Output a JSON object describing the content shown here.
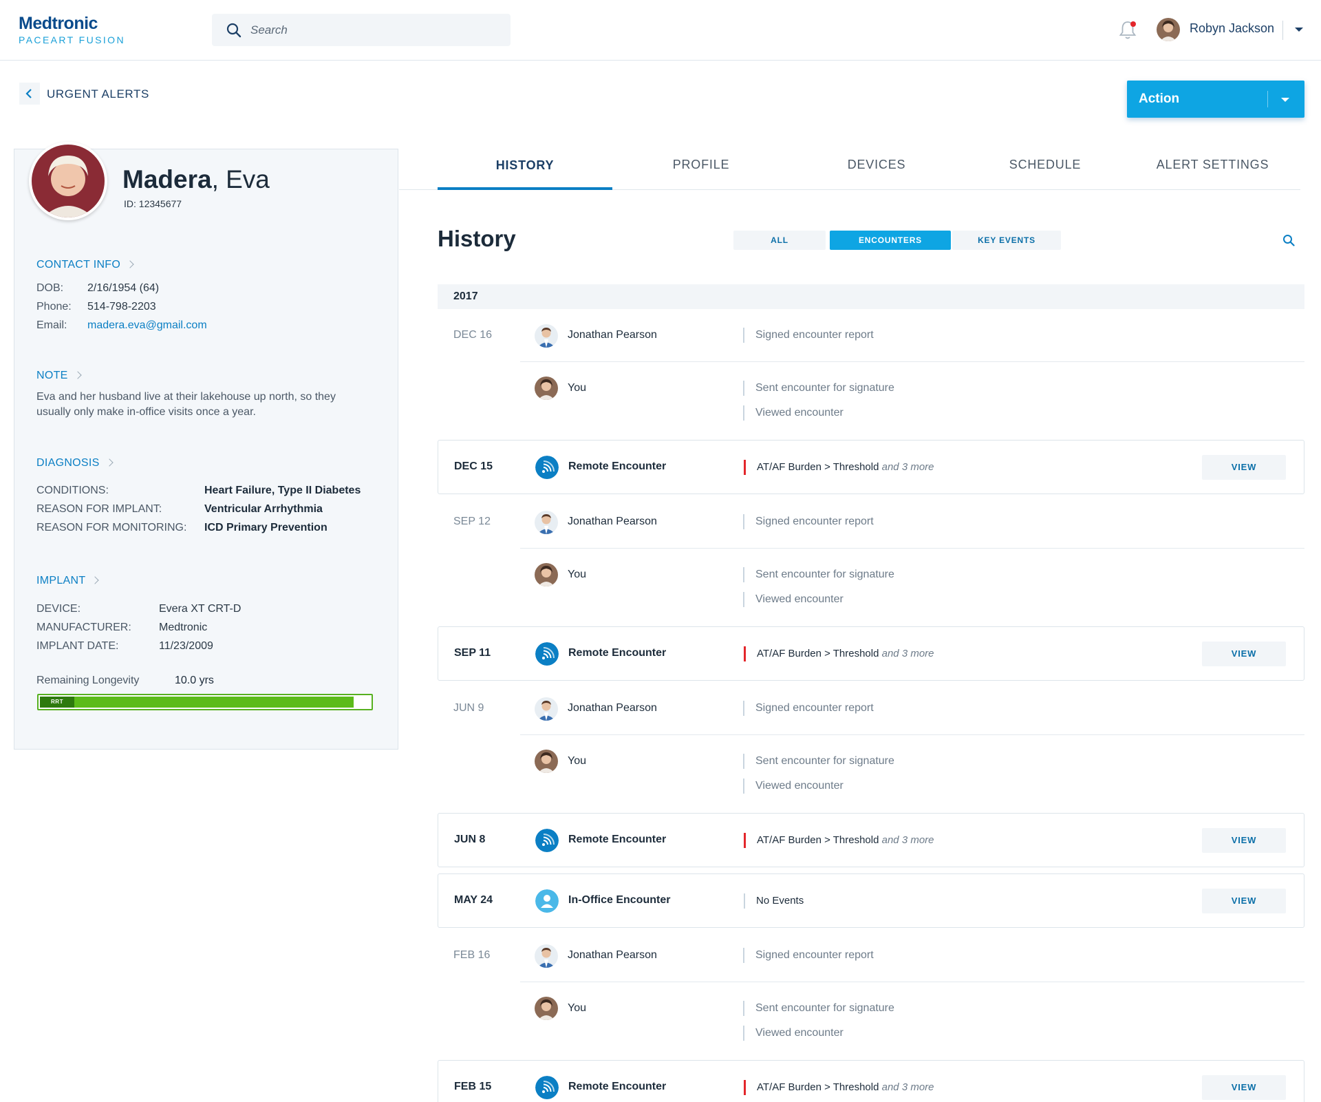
{
  "header": {
    "brand_line1": "Medtronic",
    "brand_line2": "PACEART FUSION",
    "search_placeholder": "Search",
    "user_name": "Robyn Jackson"
  },
  "nav": {
    "back_label": "URGENT ALERTS",
    "action_label": "Action"
  },
  "patient": {
    "last_name": "Madera",
    "first_name": "Eva",
    "id_label": "ID: 12345677",
    "contact_heading": "CONTACT INFO",
    "contact": [
      {
        "label": "DOB:",
        "value": "2/16/1954 (64)"
      },
      {
        "label": "Phone:",
        "value": "514-798-2203"
      },
      {
        "label": "Email:",
        "value": "madera.eva@gmail.com"
      }
    ],
    "note_heading": "NOTE",
    "note_text": "Eva and her husband live at their lakehouse up north, so they usually only make in-office visits once a year.",
    "diagnosis_heading": "DIAGNOSIS",
    "diagnosis": [
      {
        "label": "CONDITIONS:",
        "value": "Heart Failure, Type II Diabetes"
      },
      {
        "label": "REASON FOR IMPLANT:",
        "value": "Ventricular Arrhythmia"
      },
      {
        "label": "REASON FOR MONITORING:",
        "value": "ICD Primary Prevention"
      }
    ],
    "implant_heading": "IMPLANT",
    "implant": [
      {
        "label": "DEVICE:",
        "value": "Evera XT CRT-D"
      },
      {
        "label": "MANUFACTURER:",
        "value": "Medtronic"
      },
      {
        "label": "IMPLANT DATE:",
        "value": "11/23/2009"
      }
    ],
    "longevity_label": "Remaining Longevity",
    "longevity_value": "10.0 yrs",
    "longevity_fill_fraction": 0.95,
    "rrt_label": "RRT"
  },
  "tabs": [
    {
      "label": "HISTORY",
      "active": true
    },
    {
      "label": "PROFILE",
      "active": false
    },
    {
      "label": "DEVICES",
      "active": false
    },
    {
      "label": "SCHEDULE",
      "active": false
    },
    {
      "label": "ALERT SETTINGS",
      "active": false
    }
  ],
  "history": {
    "title": "History",
    "filters": [
      {
        "label": "ALL",
        "active": false
      },
      {
        "label": "ENCOUNTERS",
        "active": true
      },
      {
        "label": "KEY EVENTS",
        "active": false
      }
    ],
    "year": "2017",
    "signed": "Signed encounter report",
    "sent": "Sent encounter for signature",
    "viewed": "Viewed encounter",
    "jp": "Jonathan Pearson",
    "you": "You",
    "remote": "Remote Encounter",
    "inoffice": "In-Office Encounter",
    "alert_main": "AT/AF Burden > Threshold",
    "alert_more": "and 3 more",
    "no_events": "No Events",
    "view": "VIEW",
    "dates": {
      "dec16": "DEC 16",
      "dec15": "DEC 15",
      "sep12": "SEP 12",
      "sep11": "SEP 11",
      "jun9": "JUN 9",
      "jun8": "JUN 8",
      "may24": "MAY 24",
      "feb16": "FEB 16",
      "feb15": "FEB 15"
    }
  },
  "colors": {
    "brand_blue": "#0a4b8c",
    "accent": "#0ea5e3",
    "alert_red": "#e3262b",
    "longevity_green": "#5cbb1a"
  }
}
